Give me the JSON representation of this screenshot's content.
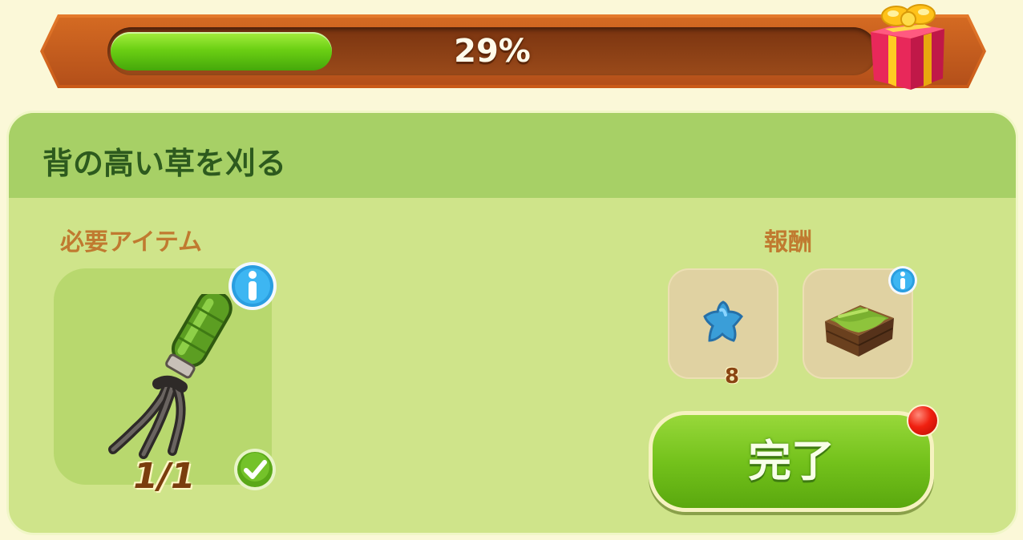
{
  "progress": {
    "percent_label": "29%",
    "fraction": 0.29,
    "fill_color": "#6cd014",
    "frame_color": "#c95a18",
    "reward_icon": "gift-box-icon"
  },
  "quest": {
    "title": "背の高い草を刈る"
  },
  "required": {
    "label": "必要アイテム",
    "item_icon": "garden-fork-icon",
    "count": "1/1",
    "completed": true,
    "info_icon": "info-icon",
    "check_icon": "checkmark-icon"
  },
  "rewards": {
    "label": "報酬",
    "items": [
      {
        "icon": "blue-star-icon",
        "quantity": "8"
      },
      {
        "icon": "grass-crate-icon",
        "info_icon": "info-icon"
      }
    ]
  },
  "actions": {
    "complete_label": "完了",
    "has_notification": true,
    "button_color": "#74c21c",
    "notification_color": "#f02010"
  }
}
